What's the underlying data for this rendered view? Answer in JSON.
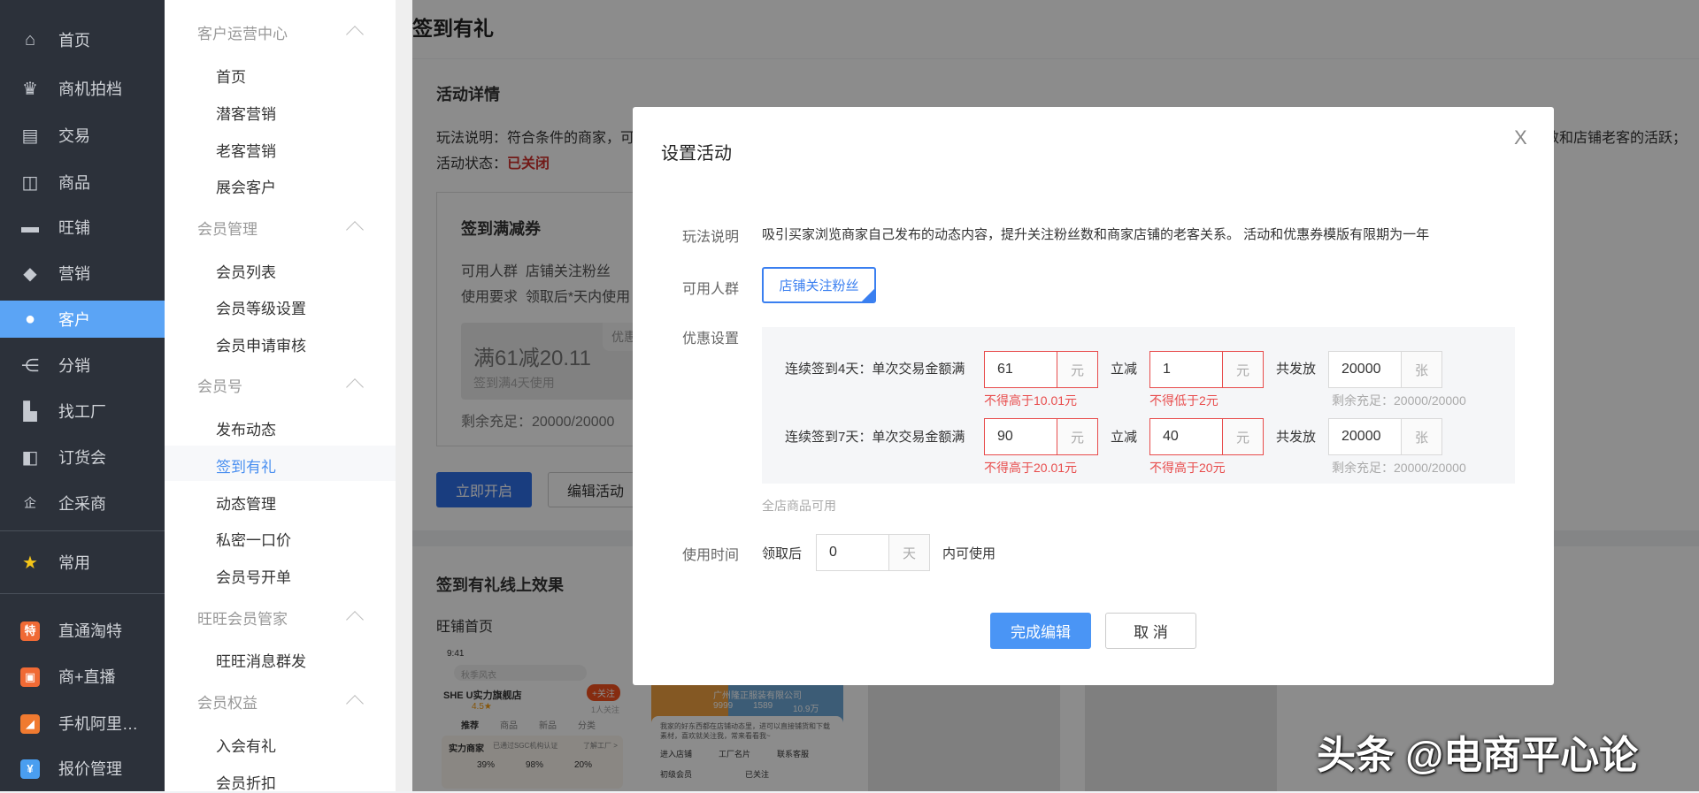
{
  "nav": {
    "items": [
      {
        "label": "首页",
        "icon": "home-icon",
        "glyph": "⌂"
      },
      {
        "label": "商机拍档",
        "icon": "crown-icon",
        "glyph": "♛"
      },
      {
        "label": "交易",
        "icon": "clipboard-icon",
        "glyph": "▤"
      },
      {
        "label": "商品",
        "icon": "bag-icon",
        "glyph": "◫"
      },
      {
        "label": "旺铺",
        "icon": "store-icon",
        "glyph": "▬"
      },
      {
        "label": "营销",
        "icon": "tag-icon",
        "glyph": "◆"
      },
      {
        "label": "客户",
        "icon": "user-icon",
        "glyph": "●"
      },
      {
        "label": "分销",
        "icon": "share-icon",
        "glyph": "⋲"
      },
      {
        "label": "找工厂",
        "icon": "factory-icon",
        "glyph": "▙"
      },
      {
        "label": "订货会",
        "icon": "booth-icon",
        "glyph": "◧"
      },
      {
        "label": "企采商",
        "icon": "enterprise-icon",
        "glyph": "企"
      }
    ],
    "common": {
      "label": "常用",
      "glyph": "★"
    },
    "apps": [
      {
        "label": "直通淘特",
        "glyph": "特",
        "color": "#f06a35"
      },
      {
        "label": "商+直播",
        "glyph": "▣",
        "color": "#f06a35"
      },
      {
        "label": "手机阿里…",
        "glyph": "◢",
        "color": "#f07a30"
      },
      {
        "label": "报价管理",
        "glyph": "¥",
        "color": "#4a9ef0"
      }
    ]
  },
  "sub": {
    "groups": [
      {
        "title": "客户运营中心",
        "items": [
          "首页",
          "潜客营销",
          "老客营销",
          "展会客户"
        ]
      },
      {
        "title": "会员管理",
        "items": [
          "会员列表",
          "会员等级设置",
          "会员申请审核"
        ]
      },
      {
        "title": "会员号",
        "items": [
          "发布动态",
          "签到有礼",
          "动态管理",
          "私密一口价",
          "会员号开单"
        ]
      },
      {
        "title": "旺旺会员管家",
        "items": [
          "旺旺消息群发"
        ]
      },
      {
        "title": "会员权益",
        "items": [
          "入会有礼",
          "会员折扣"
        ]
      }
    ],
    "active": "签到有礼"
  },
  "page": {
    "title": "签到有礼",
    "detail": {
      "title": "活动详情",
      "desc_label": "玩法说明：",
      "desc": "符合条件的商家，可以",
      "desc_tail": "数和店铺老客的活跃；",
      "status_label": "活动状态：",
      "status": "已关闭",
      "coupon": {
        "title": "签到满减券",
        "crowd_label": "可用人群",
        "crowd": "店铺关注粉丝",
        "req_label": "使用要求",
        "req": "领取后*天内使用",
        "amount": "满61减20.11",
        "cond": "签到满4天使用",
        "tag": "优惠",
        "remain": "剩余充足：20000/20000"
      },
      "open_btn": "立即开启",
      "edit_btn": "编辑活动"
    },
    "effect": {
      "title": "签到有礼线上效果",
      "sub": "旺铺首页",
      "phone1": {
        "time": "9:41",
        "search": "秋季风衣",
        "shop": "SHE U实力旗舰店",
        "follow": "+关注",
        "rating": "4.5★",
        "fans": "1人关注",
        "tabs": [
          "推荐",
          "商品",
          "新品",
          "分类"
        ],
        "badge": "实力商家",
        "cert": "已通过SGC机构认证",
        "link": "了解工厂 >",
        "stats": [
          "39%",
          "98%",
          "20%"
        ]
      },
      "phone2": {
        "company": "广州隆正服装有限公司",
        "stats": [
          "9999",
          "1589",
          "10.9万"
        ],
        "intro": "我家的好东西都在店铺动态里，进可以直接铺货和下载素材，喜欢就关注我，常来看看我~",
        "actions": [
          "进入店铺",
          "工厂名片",
          "联系客服"
        ],
        "level": "初级会员",
        "followed": "已关注"
      }
    }
  },
  "dialog": {
    "title": "设置活动",
    "close": "X",
    "desc_label": "玩法说明",
    "desc": "吸引买家浏览商家自己发布的动态内容，提升关注粉丝数和商家店铺的老客关系。 活动和优惠券模版有限期为一年",
    "crowd_label": "可用人群",
    "crowd": "店铺关注粉丝",
    "discount_label": "优惠设置",
    "rows": [
      {
        "label": "连续签到4天：单次交易金额满",
        "threshold": "61",
        "unit": "元",
        "minus_label": "立减",
        "minus": "1",
        "total_label": "共发放",
        "total": "20000",
        "total_unit": "张",
        "err1": "不得高于10.01元",
        "err2": "不得低于2元",
        "remain": "剩余充足：20000/20000"
      },
      {
        "label": "连续签到7天：单次交易金额满",
        "threshold": "90",
        "unit": "元",
        "minus_label": "立减",
        "minus": "40",
        "total_label": "共发放",
        "total": "20000",
        "total_unit": "张",
        "err1": "不得高于20.01元",
        "err2": "不得高于20元",
        "remain": "剩余充足：20000/20000"
      }
    ],
    "scope": "全店商品可用",
    "time_label": "使用时间",
    "time_prefix": "领取后",
    "time_value": "0",
    "time_unit": "天",
    "time_suffix": "内可使用",
    "ok": "完成编辑",
    "cancel": "取 消"
  },
  "watermark": "头条 @电商平心论"
}
